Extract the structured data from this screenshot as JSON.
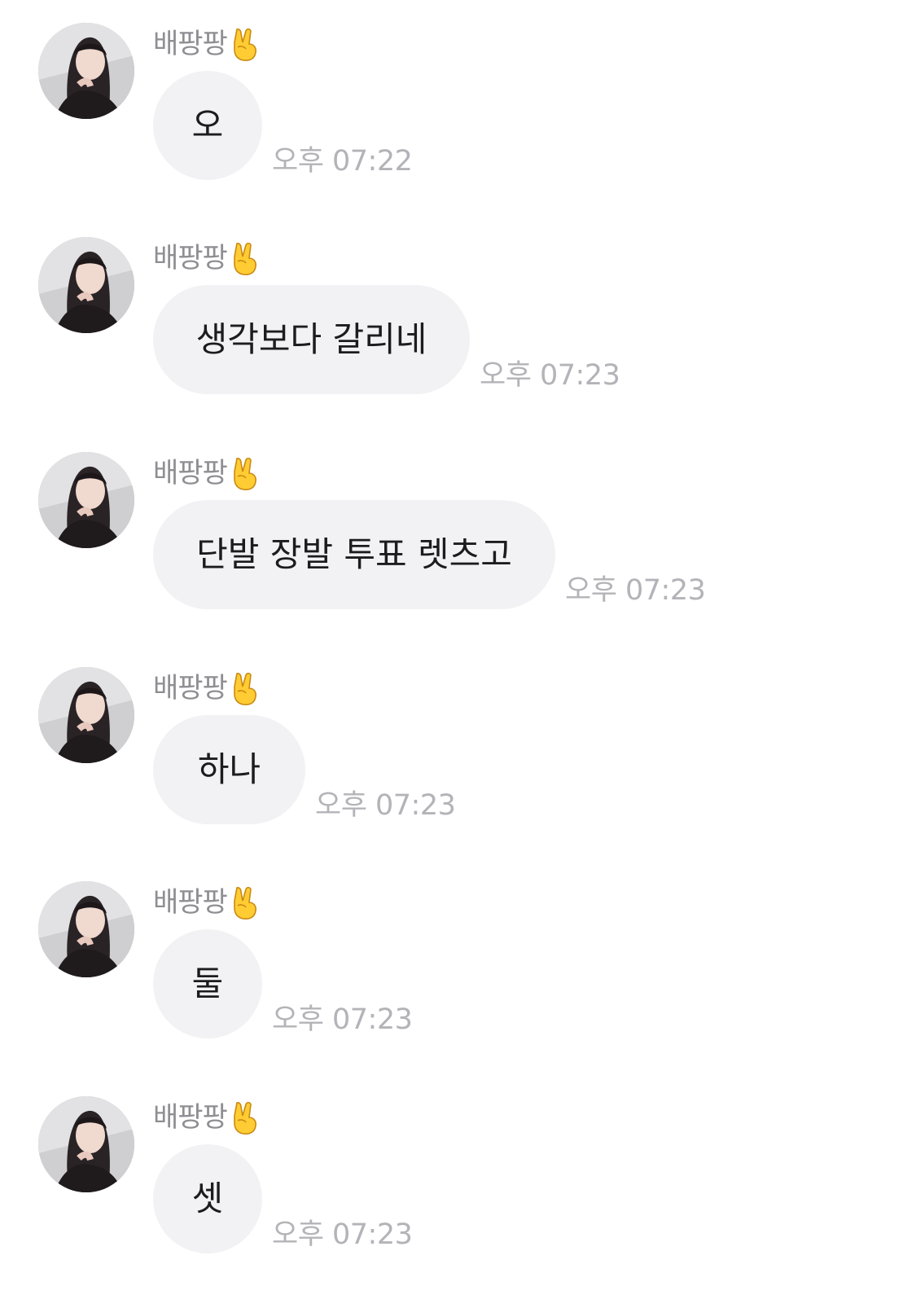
{
  "messages": [
    {
      "sender": "배팡팡",
      "sender_emoji": "victory-hand-emoji",
      "text": "오",
      "time": "오후 07:22"
    },
    {
      "sender": "배팡팡",
      "sender_emoji": "victory-hand-emoji",
      "text": "생각보다 갈리네",
      "time": "오후 07:23"
    },
    {
      "sender": "배팡팡",
      "sender_emoji": "victory-hand-emoji",
      "text": "단발 장발 투표 렛츠고",
      "time": "오후 07:23"
    },
    {
      "sender": "배팡팡",
      "sender_emoji": "victory-hand-emoji",
      "text": "하나",
      "time": "오후 07:23"
    },
    {
      "sender": "배팡팡",
      "sender_emoji": "victory-hand-emoji",
      "text": "둘",
      "time": "오후 07:23"
    },
    {
      "sender": "배팡팡",
      "sender_emoji": "victory-hand-emoji",
      "text": "셋",
      "time": "오후 07:23"
    }
  ],
  "colors": {
    "bubble": "#f2f2f4",
    "text": "#1c1c1e",
    "sender": "#8e8e93",
    "time": "#b3b3b8"
  }
}
